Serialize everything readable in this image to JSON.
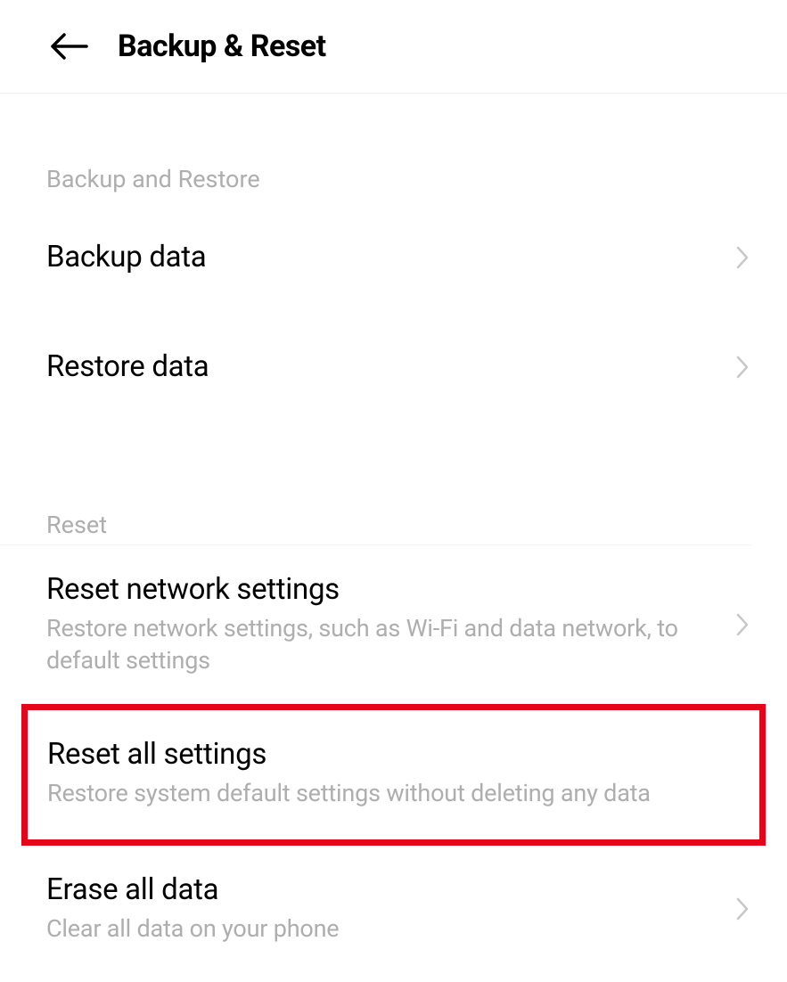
{
  "header": {
    "title": "Backup & Reset"
  },
  "sections": {
    "backup_restore": {
      "header": "Backup and Restore",
      "items": {
        "backup_data": {
          "title": "Backup data"
        },
        "restore_data": {
          "title": "Restore data"
        }
      }
    },
    "reset": {
      "header": "Reset",
      "items": {
        "reset_network": {
          "title": "Reset network settings",
          "subtitle": "Restore network settings, such as Wi-Fi and data network, to default settings"
        },
        "reset_all": {
          "title": "Reset all settings",
          "subtitle": "Restore system default settings without deleting any data"
        },
        "erase_all": {
          "title": "Erase all data",
          "subtitle": "Clear all data on your phone"
        }
      }
    }
  }
}
